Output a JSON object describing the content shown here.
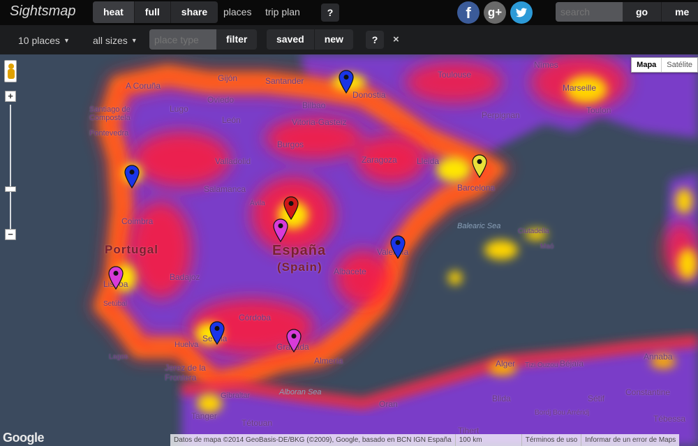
{
  "header": {
    "logo": "Sightsmap",
    "view_modes": [
      "heat",
      "full",
      "share"
    ],
    "nav": [
      "places",
      "trip plan"
    ],
    "help": "?",
    "social": [
      "f",
      "g+",
      "t"
    ],
    "search_placeholder": "search",
    "go": "go",
    "me": "me"
  },
  "toolbar": {
    "places_count": "10 places",
    "sizes": "all sizes",
    "place_type_placeholder": "place type",
    "filter": "filter",
    "saved": "saved",
    "new": "new",
    "help": "?",
    "close": "×"
  },
  "map": {
    "map_types": [
      "Mapa",
      "Satélite"
    ],
    "labels": {
      "country_es_line1": "España",
      "country_es_line2": "(Spain)",
      "country_pt": "Portugal",
      "toulouse": "Toulouse",
      "nimes": "Nîmes",
      "marseille": "Marseille",
      "toulon": "Toulon",
      "perpignan": "Perpignan",
      "santander": "Santander",
      "gijon": "Gijón",
      "oviedo": "Oviedo",
      "a_coruna": "A Coruña",
      "santiago": "Santiago de Compostela",
      "lugo": "Lugo",
      "pontevedra": "Pontevedra",
      "leon": "León",
      "bilbao": "Bilbao",
      "donostia": "Donostia",
      "vitoria": "Vitoria-Gasteiz",
      "burgos": "Burgos",
      "valladolid": "Valladolid",
      "zaragoza": "Zaragoza",
      "lleida": "Lleida",
      "barcelona": "Barcelona",
      "salamanca": "Salamanca",
      "avila": "Ávila",
      "coimbra": "Coimbra",
      "lisboa": "Lisboa",
      "badajoz": "Badajoz",
      "albacete": "Albacete",
      "valencia": "Valencia",
      "cordoba": "Córdoba",
      "sevilla": "Sevilla",
      "granada": "Granada",
      "almeria": "Almería",
      "huelva": "Huelva",
      "jerez": "Jerez de la Frontera",
      "gibraltar": "Gibraltar",
      "tanger": "Tanger",
      "tetouan": "Tétouan",
      "oran": "Oran",
      "alger": "Alger",
      "bejaia": "Béjaïa",
      "annaba": "Annaba",
      "constantine": "Constantine",
      "setif": "Sétif",
      "blida": "Blida",
      "tizi": "Tizi Ouzou",
      "bordj": "Bordj Bou Arréridj",
      "tebessa": "Tébessa",
      "tiaret": "Tihert",
      "balearic": "Balearic Sea",
      "alboran": "Alboran Sea",
      "ciutadella": "Ciutadella",
      "mao": "Maó",
      "lagos": "Lagos",
      "setubal": "Setúbal"
    },
    "pins": [
      {
        "name": "pin-santander",
        "color": "#1a35e8"
      },
      {
        "name": "pin-porto",
        "color": "#1a35e8"
      },
      {
        "name": "pin-barcelona",
        "color": "#e8e03a"
      },
      {
        "name": "pin-segovia",
        "color": "#d01818"
      },
      {
        "name": "pin-madrid",
        "color": "#d83bd8"
      },
      {
        "name": "pin-valencia",
        "color": "#1a35e8"
      },
      {
        "name": "pin-lisboa",
        "color": "#d83bd8"
      },
      {
        "name": "pin-sevilla",
        "color": "#1a35e8"
      },
      {
        "name": "pin-granada",
        "color": "#d83bd8"
      }
    ],
    "footer": {
      "attribution": "Datos de mapa ©2014 GeoBasis-DE/BKG (©2009), Google, basado en BCN IGN España",
      "scale": "100 km",
      "terms": "Términos de uso",
      "report": "Informar de un error de Maps"
    },
    "google": "Google"
  }
}
